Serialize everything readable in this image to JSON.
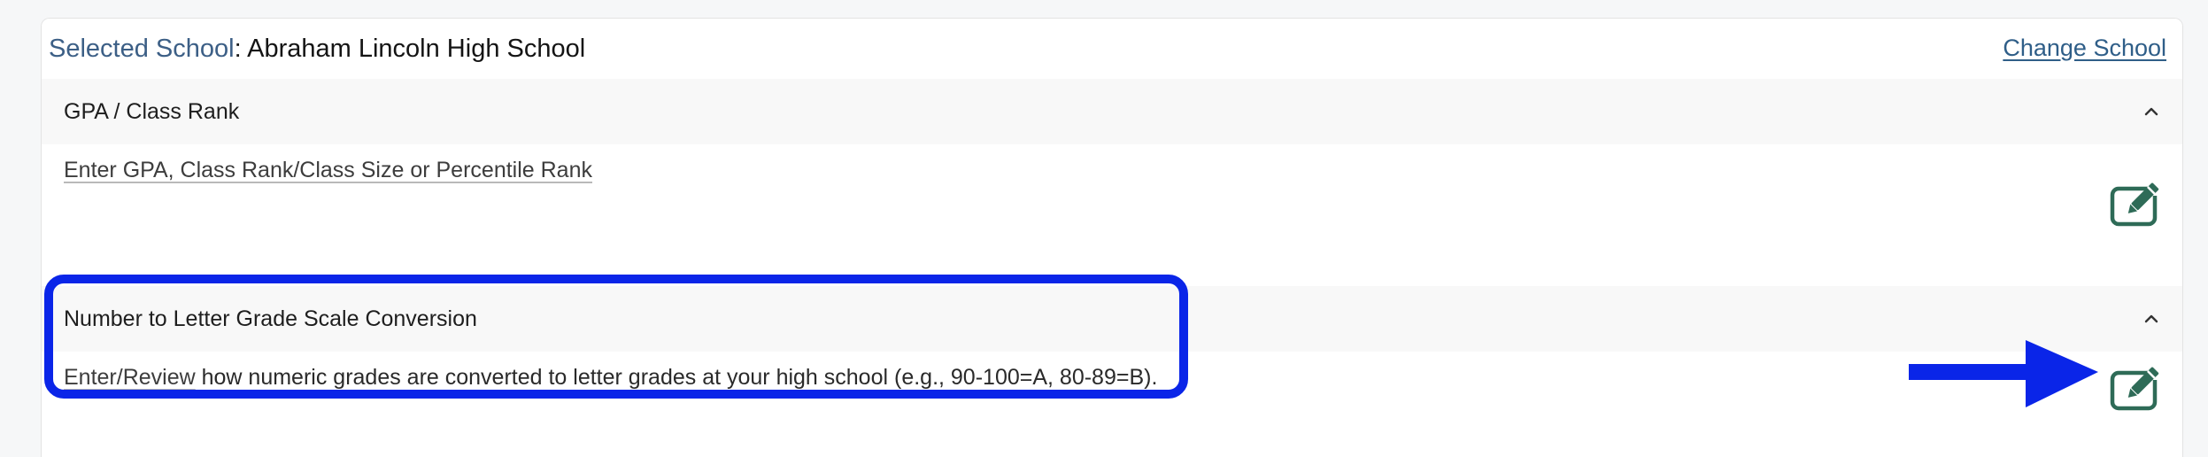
{
  "header": {
    "selected_label": "Selected School",
    "colon": ":",
    "school_name": "Abraham Lincoln High School",
    "change_link": "Change School"
  },
  "sections": [
    {
      "title": "GPA / Class Rank",
      "link_text": "Enter GPA, Class Rank/Class Size or Percentile Rank",
      "text_after": "",
      "icons": {
        "collapse": "chevron-up-icon",
        "edit": "edit-pencil-icon"
      }
    },
    {
      "title": "Number to Letter Grade Scale Conversion",
      "link_text": "Enter/Review",
      "text_after": " how numeric grades are converted to letter grades at your high school (e.g., 90-100=A, 80-89=B).",
      "icons": {
        "collapse": "chevron-up-icon",
        "edit": "edit-pencil-icon"
      }
    }
  ],
  "colors": {
    "label_blue": "#3c5f86",
    "link_blue": "#2f5e88",
    "edit_green": "#2e6b57",
    "annotation_blue": "#0a25e8"
  }
}
